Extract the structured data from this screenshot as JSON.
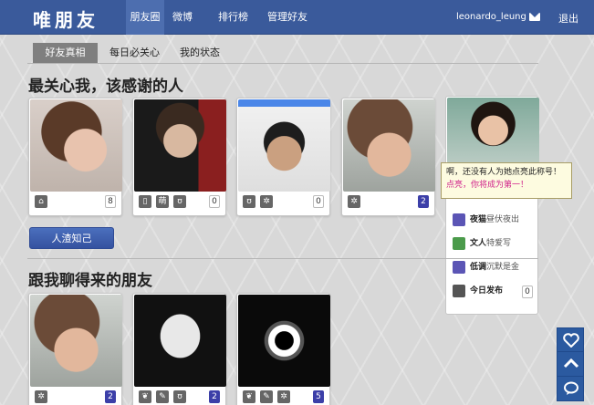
{
  "brand": "唯朋友",
  "nav": [
    "朋友圈",
    "微博",
    "排行榜",
    "管理好友"
  ],
  "user": {
    "name": "leonardo_leung",
    "logout": "退出"
  },
  "tabs": [
    "好友真相",
    "每日必关心",
    "我的状态"
  ],
  "section1": {
    "title": "最关心我，该感谢的人",
    "cards": [
      {
        "icons": [
          "home-icon"
        ],
        "count": "8",
        "highlight": false
      },
      {
        "icons": [
          "phone-icon",
          "mood-icon",
          "bear-icon"
        ],
        "count": "0",
        "highlight": false
      },
      {
        "icons": [
          "bear-icon",
          "snowflake-icon"
        ],
        "count": "0",
        "highlight": false
      },
      {
        "icons": [
          "snowflake-icon"
        ],
        "count": "2",
        "highlight": true
      }
    ],
    "button": "人渣知己"
  },
  "popup": {
    "line1": "啊，还没有人为她点亮此称号！",
    "line2": "点亮，你将成为第一！"
  },
  "panel": {
    "items": [
      {
        "title": "夜猫",
        "desc": "昼伏夜出",
        "color": "#5b55b5"
      },
      {
        "title": "文人",
        "desc": "特爱写",
        "color": "#4b9b4b"
      },
      {
        "title": "低调",
        "desc": "沉默是金",
        "color": "#5b55b5"
      },
      {
        "title": "今日发布",
        "desc": "",
        "count": "0",
        "color": "#555555"
      }
    ]
  },
  "section2": {
    "title": "跟我聊得来的朋友",
    "cards": [
      {
        "icons": [
          "snowflake-icon"
        ],
        "count": "2",
        "highlight": true
      },
      {
        "icons": [
          "leaf-icon",
          "pin-icon",
          "bear-icon"
        ],
        "count": "2",
        "highlight": true
      },
      {
        "icons": [
          "leaf-icon",
          "pin-icon",
          "snowflake-icon"
        ],
        "count": "5",
        "highlight": true
      }
    ]
  },
  "colors": {
    "header": "#3a5a9b",
    "accent": "#3c3fa8",
    "popupText": "#d0218a"
  }
}
